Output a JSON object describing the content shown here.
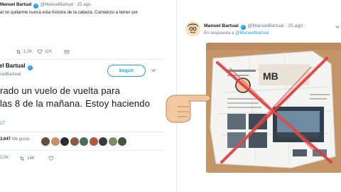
{
  "tweet1": {
    "name": "Manuel Bartual",
    "handle": "@ManuelBartual",
    "date": "· 25 ago.",
    "text": "al no quitarme nunca esta historia de la cabeza. Comienzo a temer por",
    "retweets": "1,2K",
    "likes": "11K"
  },
  "tweet2": {
    "name": "el Bartual",
    "handle": "uelBartual",
    "follow_label": "Seguir",
    "lines": [
      "rado un vuelo de vuelta para",
      "las 8 de la mañana. Estoy haciendo"
    ],
    "time": "17",
    "likes_count": "3.647",
    "likes_label": "Me gusta",
    "replies": "2,0K",
    "retweets": "14K"
  },
  "reply": {
    "name": "Manuel Bartual",
    "handle": "@ManuelBartual",
    "date": "· 25 ago.",
    "reply_prefix": "En respuesta a",
    "reply_to": "@ManuelBartual"
  },
  "colors": {
    "accent": "#1da1f2",
    "muted": "#657786",
    "verified": "#1da1f2",
    "cross": "#e03a3a"
  },
  "icons": [
    "retweet-icon",
    "heart-icon",
    "mail-icon",
    "chevron-down-icon",
    "verified-icon",
    "pointing-hand-emoji"
  ]
}
